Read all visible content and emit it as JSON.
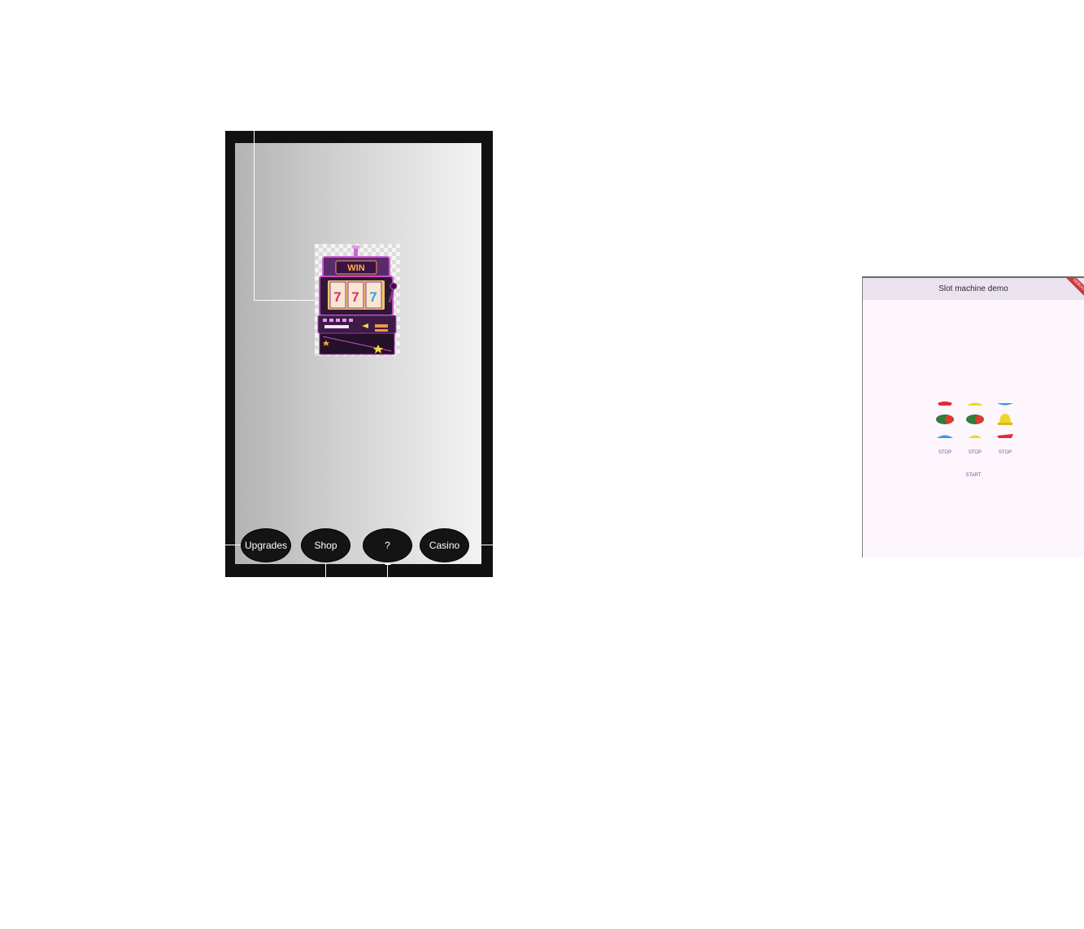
{
  "game": {
    "machine_image": "slot-machine",
    "machine_sign": "WIN",
    "machine_reels": [
      "7",
      "7",
      "7"
    ],
    "nav": {
      "upgrades": "Upgrades",
      "shop": "Shop",
      "help": "?",
      "casino": "Casino"
    }
  },
  "demo": {
    "title": "Slot machine demo",
    "banner": "DEBUG",
    "reels": [
      {
        "symbols": [
          "cherry-icon",
          "watermelon-icon",
          "blueberry-icon"
        ]
      },
      {
        "symbols": [
          "banana-icon",
          "watermelon-icon",
          "banana-icon"
        ]
      },
      {
        "symbols": [
          "blueberry-icon",
          "bell-icon",
          "cherry-icon"
        ]
      }
    ],
    "stop_labels": [
      "STOP",
      "STOP",
      "STOP"
    ],
    "start_label": "START"
  }
}
